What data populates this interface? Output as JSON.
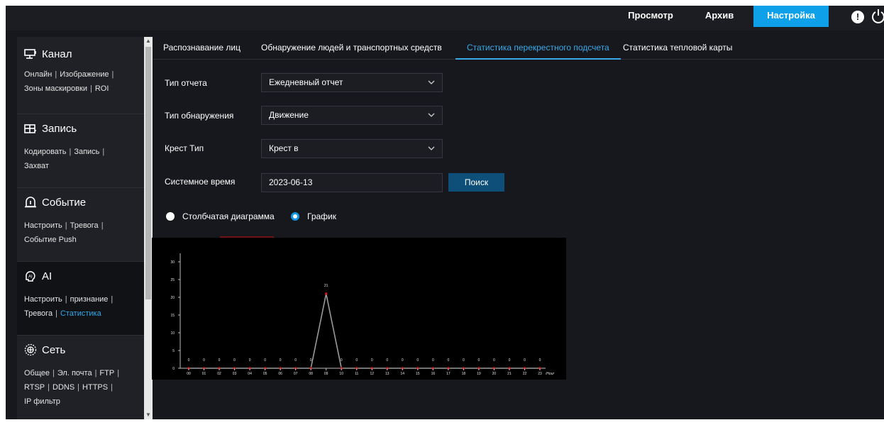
{
  "topnav": {
    "preview": "Просмотр",
    "archive": "Архив",
    "settings": "Настройка",
    "alert_glyph": "!"
  },
  "sidebar": {
    "channel": {
      "title": "Канал",
      "links": [
        "Онлайн",
        "Изображение",
        "Зоны маскировки",
        "ROI"
      ]
    },
    "record": {
      "title": "Запись",
      "links": [
        "Кодировать",
        "Запись",
        "Захват"
      ]
    },
    "event": {
      "title": "Событие",
      "links": [
        "Настроить",
        "Тревога",
        "Событие Push"
      ]
    },
    "ai": {
      "title": "AI",
      "links": [
        "Настроить",
        "признание",
        "Тревога",
        "Статистика"
      ],
      "active_link": "Статистика"
    },
    "network": {
      "title": "Сеть",
      "links": [
        "Общее",
        "Эл. почта",
        "FTP",
        "RTSP",
        "DDNS",
        "HTTPS",
        "IP фильтр"
      ]
    }
  },
  "tabs": [
    "Распознавание лиц",
    "Обнаружение людей и транспортных средств",
    "Статистика перекрестного подсчета",
    "Статистика тепловой карты"
  ],
  "active_tab": "Статистика перекрестного подсчета",
  "form": {
    "report_type_label": "Тип отчета",
    "report_type_value": "Ежедневный отчет",
    "detection_type_label": "Тип обнаружения",
    "detection_type_value": "Движение",
    "cross_type_label": "Крест Тип",
    "cross_type_value": "Крест в",
    "system_time_label": "Системное время",
    "system_time_value": "2023-06-13",
    "search_button": "Поиск",
    "radio_bar": "Столбчатая диаграмма",
    "radio_line": "График",
    "selected_view": "График"
  },
  "colors": {
    "accent": "#0ea0e8",
    "tab_active": "#3aa9e8",
    "search_button": "#0d4f78",
    "point_marker": "#d01818",
    "line": "#9a9a9a"
  },
  "chart_data": {
    "type": "line",
    "x": [
      "00",
      "01",
      "02",
      "03",
      "04",
      "05",
      "06",
      "07",
      "08",
      "09",
      "10",
      "11",
      "12",
      "13",
      "14",
      "15",
      "16",
      "17",
      "18",
      "19",
      "20",
      "21",
      "22",
      "23"
    ],
    "x_unit": "Hour",
    "values": [
      0,
      0,
      0,
      0,
      0,
      0,
      0,
      0,
      0,
      21,
      0,
      0,
      0,
      0,
      0,
      0,
      0,
      0,
      0,
      0,
      0,
      0,
      0,
      0
    ],
    "y_ticks": [
      0,
      5,
      10,
      15,
      20,
      25,
      30
    ],
    "ylim": [
      0,
      30
    ],
    "data_labels": [
      "0",
      "0",
      "0",
      "0",
      "0",
      "0",
      "0",
      "0",
      "0",
      "21",
      "0",
      "0",
      "0",
      "0",
      "0",
      "0",
      "0",
      "0",
      "0",
      "0",
      "0",
      "0",
      "0",
      "0"
    ],
    "grid": false
  }
}
